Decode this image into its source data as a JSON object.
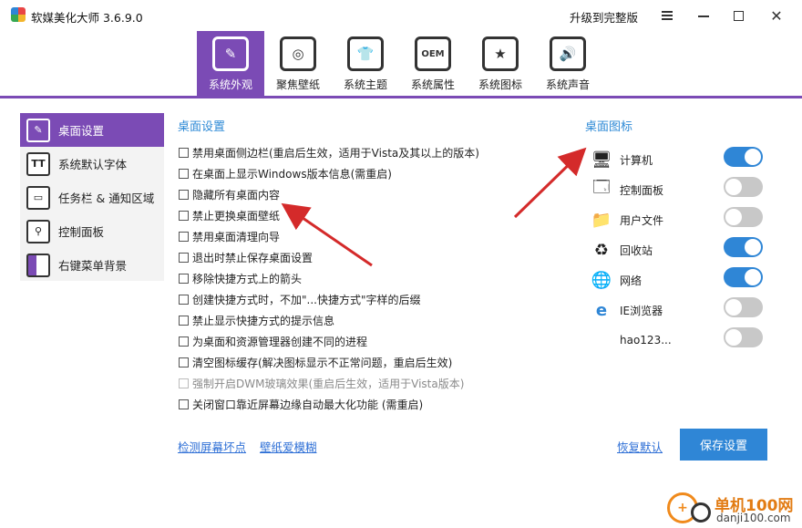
{
  "window": {
    "title": "软媒美化大师 3.6.9.0",
    "upgrade_label": "升级到完整版"
  },
  "tabs": [
    {
      "label": "系统外观",
      "icon": "brush-icon",
      "active": true
    },
    {
      "label": "聚焦壁纸",
      "icon": "target-icon",
      "active": false
    },
    {
      "label": "系统主题",
      "icon": "tshirt-icon",
      "active": false
    },
    {
      "label": "系统属性",
      "icon": "oem-icon",
      "glyph": "OEM",
      "active": false
    },
    {
      "label": "系统图标",
      "icon": "star-icon",
      "active": false
    },
    {
      "label": "系统声音",
      "icon": "speaker-icon",
      "active": false
    }
  ],
  "sidebar": {
    "items": [
      {
        "label": "桌面设置",
        "icon": "brush-icon",
        "active": true
      },
      {
        "label": "系统默认字体",
        "icon": "font-icon",
        "glyph": "TT",
        "active": false
      },
      {
        "label": "任务栏 & 通知区域",
        "icon": "taskbar-icon",
        "active": false
      },
      {
        "label": "控制面板",
        "icon": "search-panel-icon",
        "active": false
      },
      {
        "label": "右键菜单背景",
        "icon": "context-menu-icon",
        "active": false
      }
    ]
  },
  "desktop_settings": {
    "title": "桌面设置",
    "options": [
      {
        "label": "禁用桌面侧边栏(重启后生效，适用于Vista及其以上的版本)",
        "checked": false,
        "disabled": false
      },
      {
        "label": "在桌面上显示Windows版本信息(需重启)",
        "checked": false,
        "disabled": false
      },
      {
        "label": "隐藏所有桌面内容",
        "checked": false,
        "disabled": false
      },
      {
        "label": "禁止更换桌面壁纸",
        "checked": false,
        "disabled": false
      },
      {
        "label": "禁用桌面清理向导",
        "checked": false,
        "disabled": false
      },
      {
        "label": "退出时禁止保存桌面设置",
        "checked": false,
        "disabled": false
      },
      {
        "label": "移除快捷方式上的箭头",
        "checked": false,
        "disabled": false
      },
      {
        "label": "创建快捷方式时，不加\"...快捷方式\"字样的后缀",
        "checked": false,
        "disabled": false
      },
      {
        "label": "禁止显示快捷方式的提示信息",
        "checked": false,
        "disabled": false
      },
      {
        "label": "为桌面和资源管理器创建不同的进程",
        "checked": false,
        "disabled": false
      },
      {
        "label": "清空图标缓存(解决图标显示不正常问题，重启后生效)",
        "checked": false,
        "disabled": false
      },
      {
        "label": "强制开启DWM玻璃效果(重启后生效，适用于Vista版本)",
        "checked": false,
        "disabled": true
      },
      {
        "label": "关闭窗口靠近屏幕边缘自动最大化功能 (需重启)",
        "checked": false,
        "disabled": false
      }
    ]
  },
  "desktop_icons": {
    "title": "桌面图标",
    "items": [
      {
        "label": "计算机",
        "icon": "computer-icon",
        "on": true
      },
      {
        "label": "控制面板",
        "icon": "control-panel-icon",
        "on": false
      },
      {
        "label": "用户文件",
        "icon": "user-folder-icon",
        "on": false
      },
      {
        "label": "回收站",
        "icon": "recycle-bin-icon",
        "on": true
      },
      {
        "label": "网络",
        "icon": "network-icon",
        "on": true
      },
      {
        "label": "IE浏览器",
        "icon": "ie-icon",
        "on": false
      },
      {
        "label": "hao123...",
        "icon": "",
        "on": false
      }
    ]
  },
  "footer": {
    "link1": "检测屏幕坏点",
    "link2": "壁纸爱模糊",
    "restore": "恢复默认",
    "save": "保存设置"
  },
  "watermark": {
    "brand": "单机100网",
    "url": "danji100.com"
  },
  "colors": {
    "accent": "#7b4bb5",
    "blue": "#2f86d6",
    "arrow": "#d42a2a"
  }
}
